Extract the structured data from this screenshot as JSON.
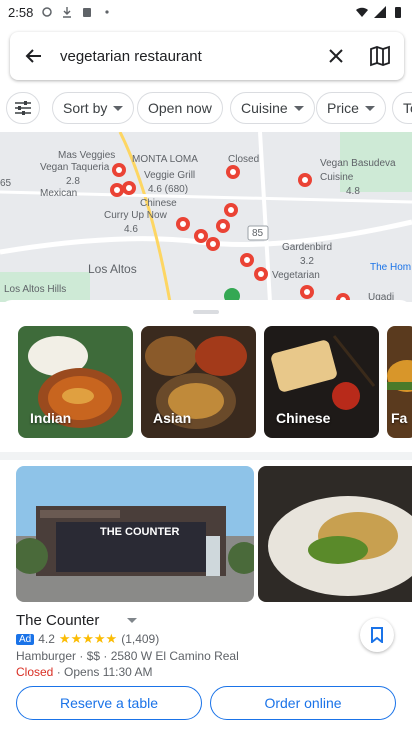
{
  "status_bar": {
    "time": "2:58",
    "icons": [
      "sync-icon",
      "download-icon",
      "clipboard-icon",
      "dot-icon",
      "wifi-icon",
      "signal-icon",
      "battery-icon"
    ]
  },
  "search": {
    "query": "vegetarian restaurant"
  },
  "chips": [
    {
      "label": ""
    },
    {
      "label": "Sort by"
    },
    {
      "label": "Open now"
    },
    {
      "label": "Cuisine"
    },
    {
      "label": "Price"
    },
    {
      "label": "To"
    }
  ],
  "map": {
    "labels": {
      "mas_veggies": "Mas Veggies",
      "vegan_taqueria": "Vegan Taqueria",
      "mas_rating": "2.8",
      "montalona": "MONTA LOMA",
      "veggie_grill": "Veggie Grill",
      "veggie_grill_sub": "4.6 (680)",
      "chinese": "Chinese",
      "curry_up": "Curry Up Now",
      "curry_rating": "4.6",
      "vegan_basudeva": "Vegan Basudeva",
      "cuisine": "Cuisine",
      "cuisine_rating": "4.8",
      "gardenbird": "Gardenbird",
      "gardenbird_rating": "3.2",
      "vegetarian": "Vegetarian",
      "los_altos": "Los Altos",
      "los_altos_hills": "Los Altos Hills",
      "ugadi": "Ugadi",
      "route85": "85",
      "the_home": "The Hom",
      "mexican": "Mexican",
      "distance": "65",
      "closed_label": "Closed"
    }
  },
  "categories": [
    {
      "label": "Indian"
    },
    {
      "label": "Asian"
    },
    {
      "label": "Chinese"
    },
    {
      "label": "Fa"
    }
  ],
  "listing": {
    "name": "The Counter",
    "ad": "Ad",
    "rating": "4.2",
    "stars": "★★★★★",
    "reviews": "(1,409)",
    "details": "Hamburger · $$ · 2580 W El Camino Real",
    "status": "Closed",
    "hours": " · Opens 11:30 AM",
    "photo_sign": "THE COUNTER"
  },
  "actions": {
    "reserve": "Reserve a table",
    "order": "Order online"
  }
}
